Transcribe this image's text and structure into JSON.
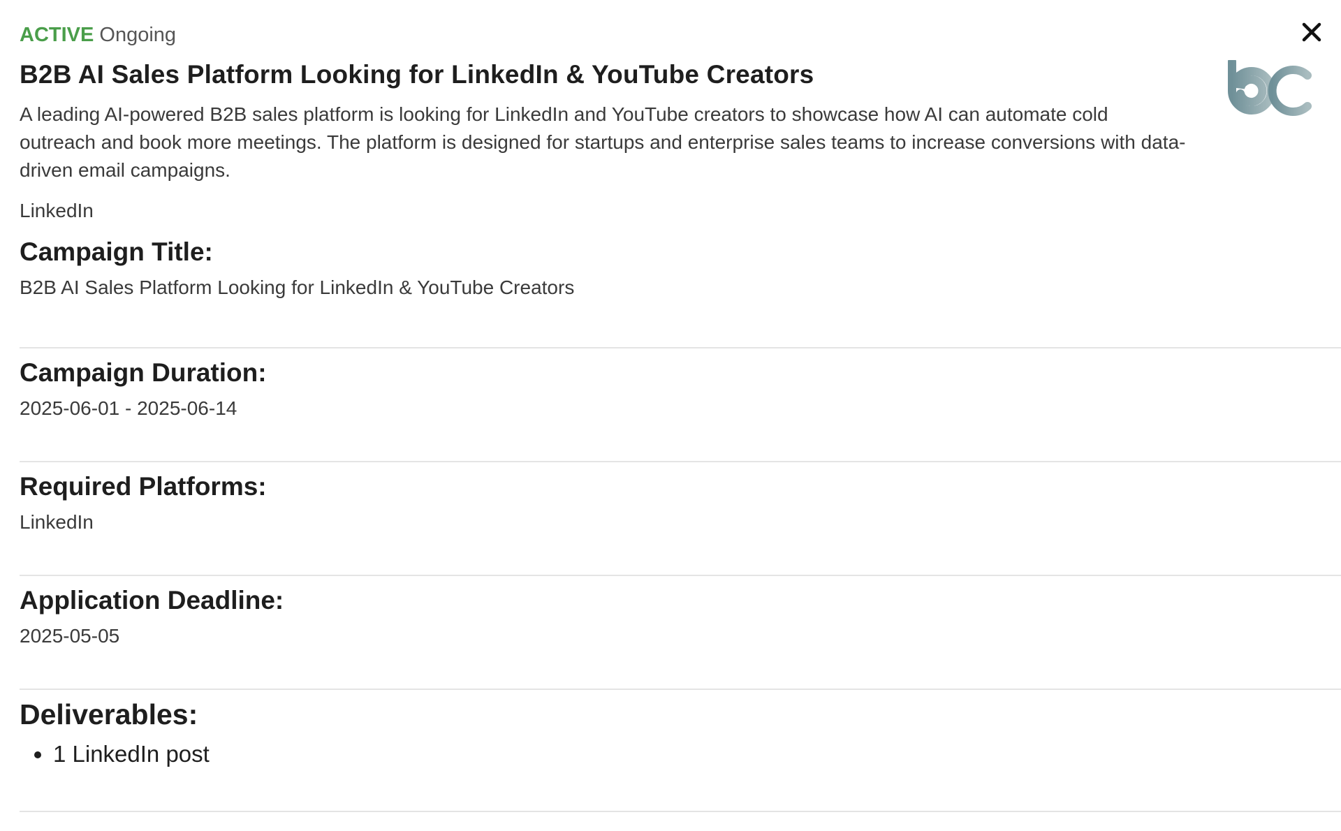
{
  "status": {
    "badge": "ACTIVE",
    "state": "Ongoing",
    "badge_color": "#4a9e4a"
  },
  "campaign": {
    "title": "B2B AI Sales Platform Looking for LinkedIn & YouTube Creators",
    "description": "A leading AI-powered B2B sales platform is looking for LinkedIn and YouTube creators to showcase how AI can automate cold outreach and book more meetings. The platform is designed for startups and enterprise sales teams to increase conversions with data-driven email campaigns.",
    "platform_tag": "LinkedIn"
  },
  "sections": {
    "title": {
      "label": "Campaign Title:",
      "value": "B2B AI Sales Platform Looking for LinkedIn & YouTube Creators"
    },
    "duration": {
      "label": "Campaign Duration:",
      "value": "2025-06-01 - 2025-06-14"
    },
    "platforms": {
      "label": "Required Platforms:",
      "value": "LinkedIn"
    },
    "deadline": {
      "label": "Application Deadline:",
      "value": "2025-05-05"
    },
    "deliverables": {
      "label": "Deliverables:",
      "items": [
        "1 LinkedIn post"
      ]
    }
  },
  "icons": {
    "close": "close-icon",
    "logo": "brand-logo"
  },
  "colors": {
    "logo_gradient_start": "#6f9098",
    "logo_gradient_end": "#a9bcbf"
  }
}
